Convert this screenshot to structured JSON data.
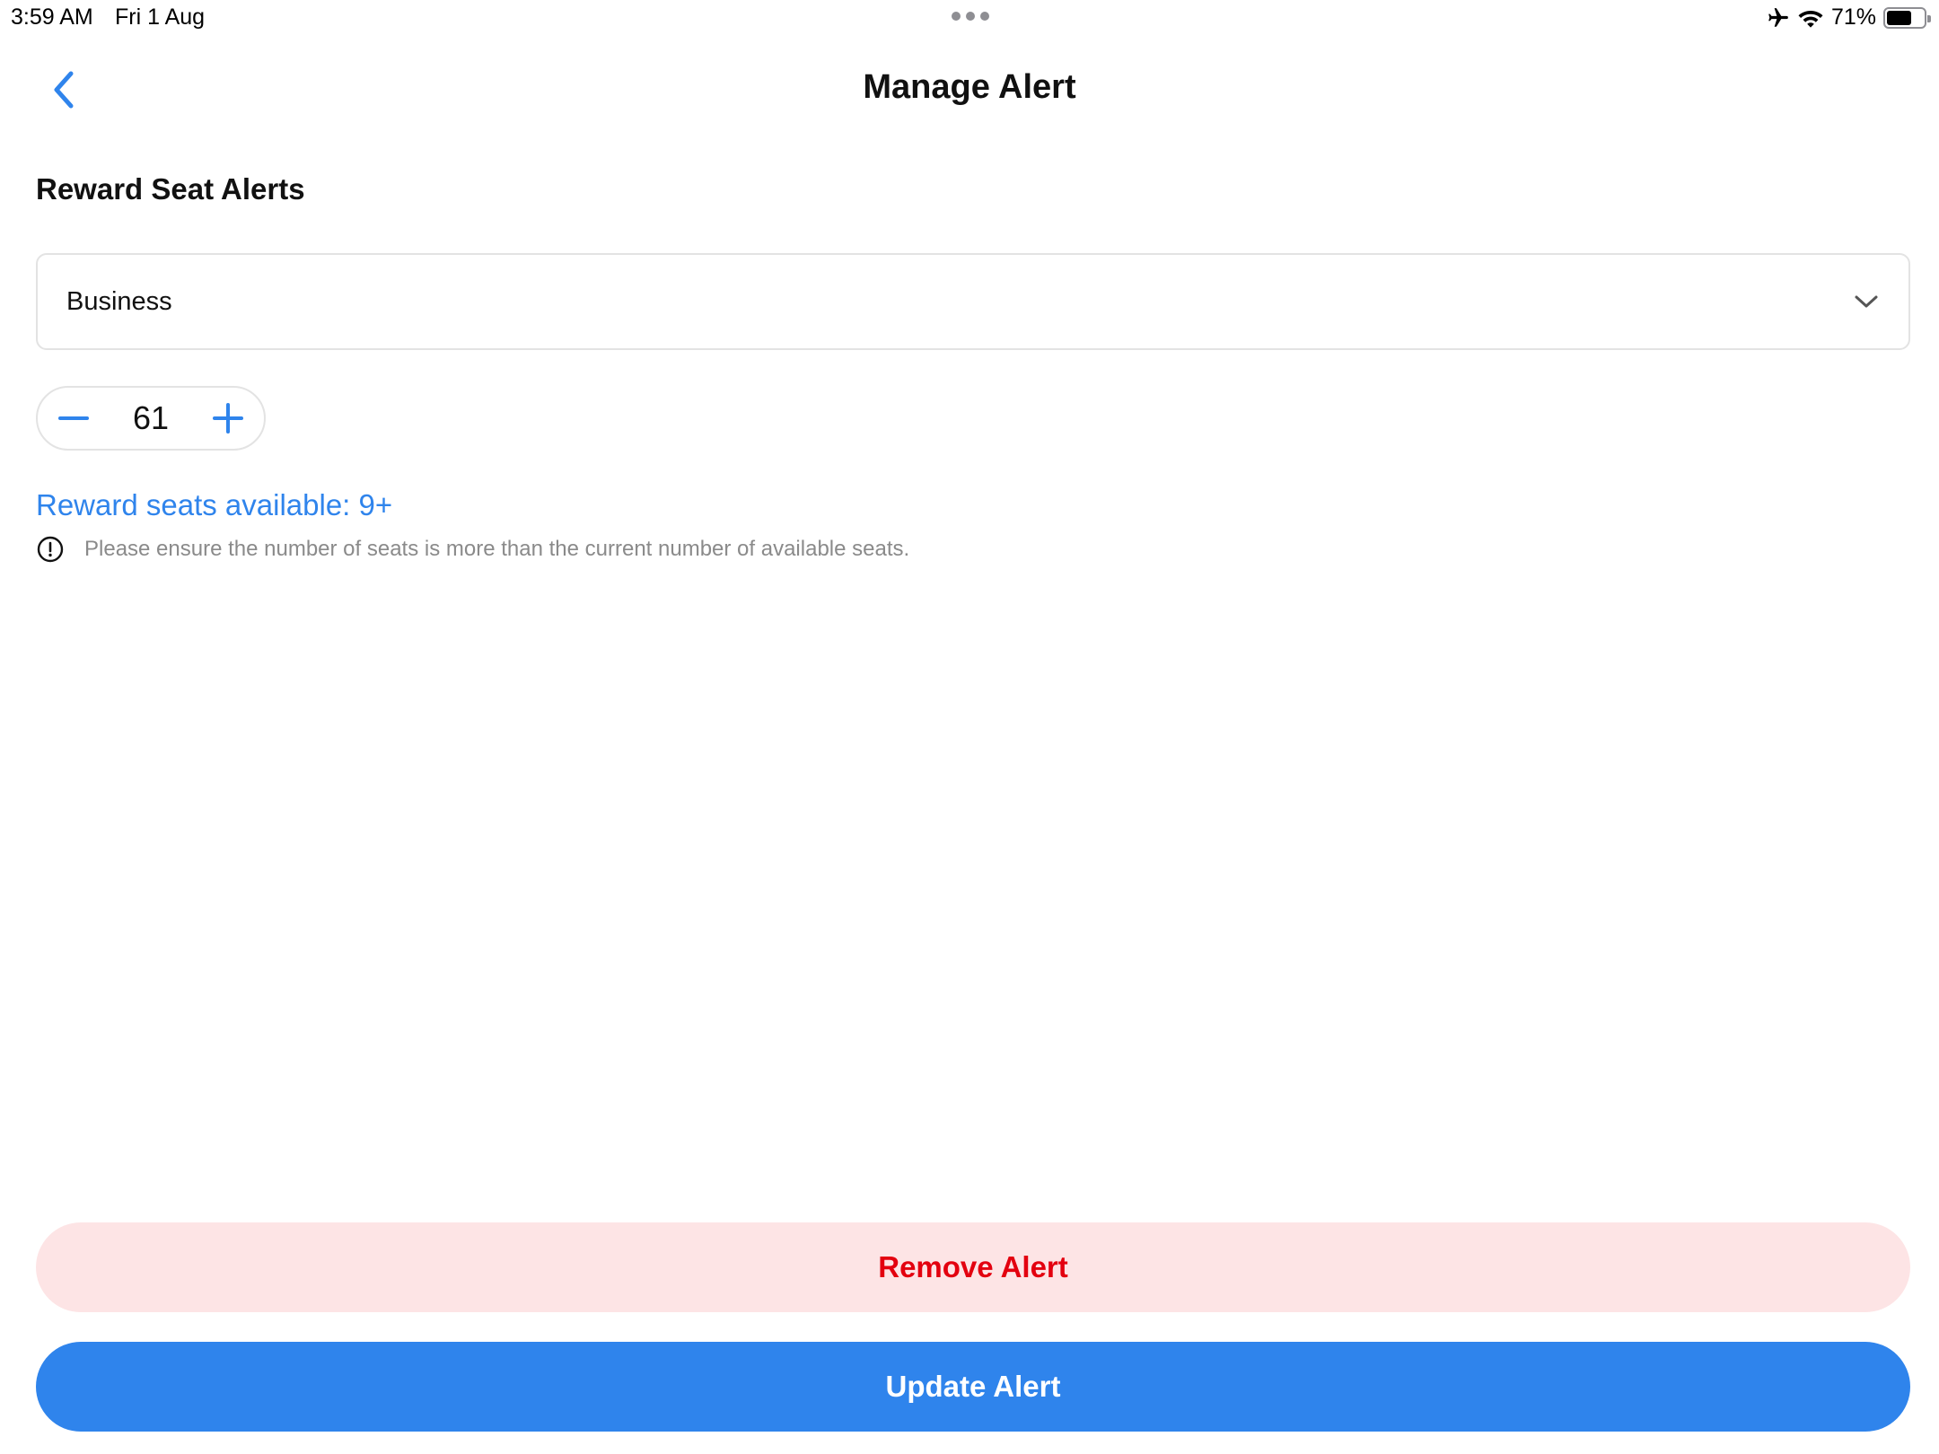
{
  "status_bar": {
    "time": "3:59 AM",
    "date": "Fri 1 Aug",
    "battery_percent": "71%",
    "battery_level": 0.71,
    "icons": [
      "airplane-icon",
      "wifi-icon",
      "battery-icon"
    ]
  },
  "header": {
    "title": "Manage Alert",
    "back_icon": "chevron-left-icon"
  },
  "section": {
    "title": "Reward Seat Alerts"
  },
  "class_select": {
    "value": "Business",
    "icon": "chevron-down-icon"
  },
  "stepper": {
    "value": "61",
    "minus_icon": "minus-icon",
    "plus_icon": "plus-icon"
  },
  "availability": {
    "text": "Reward seats available: 9+"
  },
  "notice": {
    "icon": "info-circle-icon",
    "text": "Please ensure the number of seats is more than the current number of available seats."
  },
  "actions": {
    "remove_label": "Remove Alert",
    "update_label": "Update Alert"
  },
  "colors": {
    "accent": "#2f84ec",
    "danger": "#e3000f",
    "danger_bg": "#fde4e5"
  }
}
